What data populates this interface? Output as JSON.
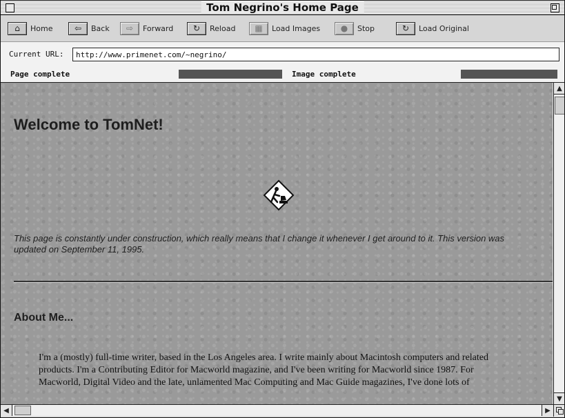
{
  "window": {
    "title": "Tom Negrino's Home Page"
  },
  "toolbar": {
    "buttons": [
      {
        "label": "Home",
        "icon": "home-icon"
      },
      {
        "label": "Back",
        "icon": "back-arrow-icon"
      },
      {
        "label": "Forward",
        "icon": "forward-arrow-icon"
      },
      {
        "label": "Reload",
        "icon": "reload-icon"
      },
      {
        "label": "Load Images",
        "icon": "load-images-icon"
      },
      {
        "label": "Stop",
        "icon": "stop-icon"
      },
      {
        "label": "Load Original",
        "icon": "load-original-icon"
      }
    ]
  },
  "url": {
    "label": "Current URL:",
    "value": "http://www.primenet.com/~negrino/"
  },
  "status": {
    "page_label": "Page complete",
    "page_progress": 1.0,
    "image_label": "Image complete",
    "image_progress": 1.0
  },
  "page": {
    "heading": "Welcome to TomNet!",
    "construction_icon": "under-construction-icon",
    "notice": "This page is constantly under construction, which really means that I change it whenever I get around to it. This version was updated on September 11, 1995.",
    "section_heading": "About Me...",
    "bio": "I'm a (mostly) full-time writer, based in the Los Angeles area. I write mainly about Macintosh computers and related products. I'm a Contributing Editor for Macworld magazine, and I've been writing for Macworld since 1987. For Macworld, Digital Video and the late, unlamented Mac Computing and Mac Guide magazines, I've done lots of"
  },
  "colors": {
    "content_background": "#9a9a9a",
    "progress_fill": "#555555",
    "chrome": "#d6d6d6"
  }
}
